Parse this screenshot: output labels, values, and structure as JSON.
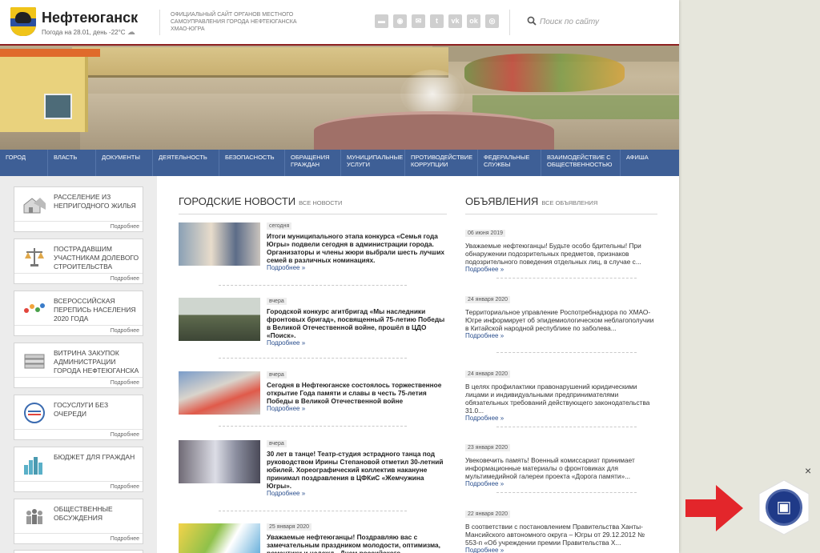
{
  "header": {
    "title": "Нефтеюганск",
    "weather": "Погода на 28.01, день -22°С",
    "description": "Официальный сайт органов местного самоуправления города Нефтеюганска ХМАО-Югра",
    "search_placeholder": "Поиск по сайту",
    "socials": [
      "mail-icon",
      "eye-icon",
      "envelope-icon",
      "twitter-icon",
      "vk-icon",
      "odnoklassniki-icon",
      "instagram-icon"
    ]
  },
  "nav": {
    "items": [
      "Город",
      "Власть",
      "Документы",
      "Деятельность",
      "Безопасность",
      "Обращения граждан",
      "Муниципальные услуги",
      "Противодействие коррупции",
      "Федеральные службы",
      "Взаимодействие с общественностью",
      "Афиша"
    ]
  },
  "sidebar": {
    "more_label": "Подробнее",
    "cards": [
      {
        "label": "Расселение из непригодного жилья",
        "icon": "houses-icon"
      },
      {
        "label": "Пострадавшим участникам долевого строительства",
        "icon": "scales-icon"
      },
      {
        "label": "Всероссийская перепись населения 2020 года",
        "icon": "census-icon"
      },
      {
        "label": "Витрина закупок администрации города Нефтеюганска",
        "icon": "books-icon"
      },
      {
        "label": "Госуслуги без очереди",
        "icon": "gosuslugi-icon"
      },
      {
        "label": "Бюджет для граждан",
        "icon": "city-chart-icon"
      },
      {
        "label": "Общественные обсуждения",
        "icon": "people-icon"
      }
    ]
  },
  "news": {
    "title": "Городские новости",
    "all_label": "все новости",
    "more_label": "Подробнее »",
    "items": [
      {
        "date": "сегодня",
        "text": "Итоги муниципального этапа конкурса «Семья года Югры» подвели сегодня в администрации города. Организаторы и члены жюри выбрали шесть лучших семей в различных номинациях."
      },
      {
        "date": "вчера",
        "text": "Городской конкурс агитбригад «Мы наследники фронтовых бригад», посвященный 75-летию Победы в Великой Отечественной войне, прошёл в ЦДО «Поиск»."
      },
      {
        "date": "вчера",
        "text": "Сегодня в Нефтеюганске состоялось торжественное открытие Года памяти и славы в честь 75-летия Победы в Великой Отечественной войне"
      },
      {
        "date": "вчера",
        "text": "30 лет в танце! Театр-студия эстрадного танца под руководством Ирины Степановой отметил 30-летний юбилей. Хореографический коллектив накануне принимал поздравления в ЦФКиС «Жемчужина Югры»."
      },
      {
        "date": "25 января 2020",
        "text": "Уважаемые нефтеюганцы! Поздравляю вас с замечательным праздником молодости, оптимизма, романтики и надежд - Днем российского"
      }
    ]
  },
  "ads": {
    "title": "Объявления",
    "all_label": "все объявления",
    "more_label": "Подробнее »",
    "items": [
      {
        "date": "06 июня 2019",
        "text": "Уважаемые нефтеюганцы! Будьте особо бдительны! При обнаружении подозрительных предметов, признаков подозрительного поведения отдельных лиц, в случае с..."
      },
      {
        "date": "24 января 2020",
        "text": "Территориальное управление Роспотребнадзора по ХМАО-Югре информирует об эпидемиологическом неблагополучии в Китайской народной республике по заболева..."
      },
      {
        "date": "24 января 2020",
        "text": "В целях профилактики правонарушений юридическими лицами и индивидуальными предпринимателями обязательных требований действующего законодательства 31.0..."
      },
      {
        "date": "23 января 2020",
        "text": "Увековечить память! Военный комиссариат принимает информационные материалы о фронтовиках для мультимедийной галереи проекта «Дорога памяти»..."
      },
      {
        "date": "22 января 2020",
        "text": "В соответствии с постановлением Правительства Ханты-Мансийского автономного округа – Югры от 29.12.2012 № 553-п «Об учреждении премии Правительства Х..."
      }
    ]
  },
  "overlay": {
    "close_label": "×",
    "badge_icon": "bus-icon",
    "arrow_color": "#e3262b",
    "badge_color": "#1f3a88"
  }
}
